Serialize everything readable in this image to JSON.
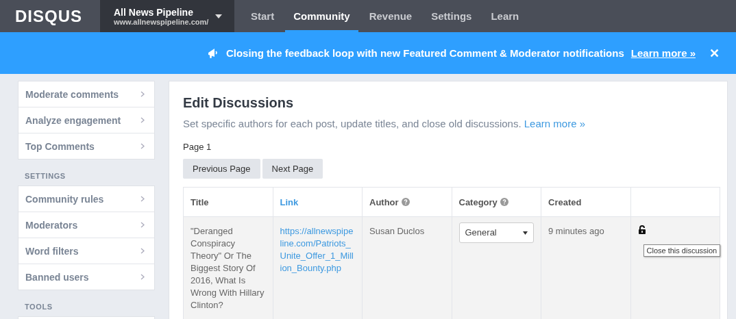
{
  "logo": "DISQUS",
  "site": {
    "name": "All News Pipeline",
    "url": "www.allnewspipeline.com/"
  },
  "nav": [
    {
      "label": "Start",
      "selected": false
    },
    {
      "label": "Community",
      "selected": true
    },
    {
      "label": "Revenue",
      "selected": false
    },
    {
      "label": "Settings",
      "selected": false
    },
    {
      "label": "Learn",
      "selected": false
    }
  ],
  "banner": {
    "text": "Closing the feedback loop with new Featured Comment & Moderator notifications",
    "link": "Learn more »",
    "close": "✕"
  },
  "sidebar": [
    {
      "items": [
        "Moderate comments",
        "Analyze engagement",
        "Top Comments"
      ]
    },
    {
      "heading": "SETTINGS",
      "items": [
        "Community rules",
        "Moderators",
        "Word filters",
        "Banned users"
      ]
    },
    {
      "heading": "TOOLS"
    }
  ],
  "main": {
    "title": "Edit Discussions",
    "description": "Set specific authors for each post, update titles, and close old discussions.",
    "description_link": "Learn more »",
    "page": "Page 1",
    "buttons": [
      "Previous Page",
      "Next Page"
    ]
  },
  "table": {
    "columns": [
      {
        "label": "Title",
        "kind": "plain",
        "help": false
      },
      {
        "label": "Link",
        "kind": "link",
        "help": false
      },
      {
        "label": "Author",
        "kind": "plain",
        "help": true
      },
      {
        "label": "Category",
        "kind": "plain",
        "help": true
      },
      {
        "label": "Created",
        "kind": "plain",
        "help": false
      }
    ],
    "rows": [
      {
        "title": "\"Deranged Conspiracy Theory\" Or The Biggest Story Of 2016, What Is Wrong With Hillary Clinton?",
        "link": "https://allnewspipeline.com/Patriots_Unite_Offer_1_Million_Bounty.php",
        "author": "Susan Duclos",
        "category": "General",
        "created": "9 minutes ago",
        "tooltip": "Close this discussion"
      }
    ]
  }
}
